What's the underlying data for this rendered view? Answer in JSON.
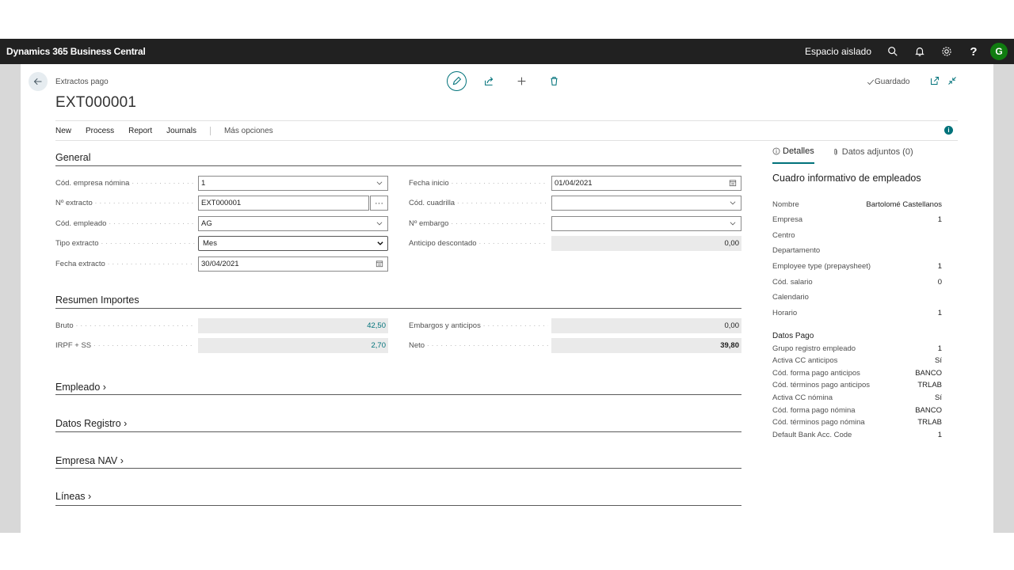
{
  "appbar": {
    "title": "Dynamics 365 Business Central",
    "sandbox": "Espacio aislado",
    "help": "?",
    "avatar": "G"
  },
  "header": {
    "caption": "Extractos pago",
    "record_no": "EXT000001",
    "saved": "Guardado"
  },
  "actions": [
    "New",
    "Process",
    "Report",
    "Journals",
    "Más opciones"
  ],
  "general": {
    "title": "General",
    "left": [
      {
        "label": "Cód. empresa nómina",
        "value": "1",
        "kind": "dropdown"
      },
      {
        "label": "Nº extracto",
        "value": "EXT000001",
        "kind": "lookup"
      },
      {
        "label": "Cód. empleado",
        "value": "AG",
        "kind": "dropdown"
      },
      {
        "label": "Tipo extracto",
        "value": "Mes",
        "kind": "select"
      },
      {
        "label": "Fecha extracto",
        "value": "30/04/2021",
        "kind": "date"
      }
    ],
    "right": [
      {
        "label": "Fecha inicio",
        "value": "01/04/2021",
        "kind": "date"
      },
      {
        "label": "Cód. cuadrilla",
        "value": "",
        "kind": "dropdown"
      },
      {
        "label": "Nº embargo",
        "value": "",
        "kind": "dropdown"
      },
      {
        "label": "Anticipo descontado",
        "value": "0,00",
        "kind": "readonly"
      }
    ]
  },
  "resumen": {
    "title": "Resumen Importes",
    "bruto_label": "Bruto",
    "bruto": "42,50",
    "irpf_label": "IRPF + SS",
    "irpf": "2,70",
    "embargos_label": "Embargos y anticipos",
    "embargos": "0,00",
    "neto_label": "Neto",
    "neto": "39,80"
  },
  "collapsed_sections": [
    "Empleado",
    "Datos Registro",
    "Empresa NAV",
    "Líneas"
  ],
  "factbox": {
    "tab_details": "Detalles",
    "tab_attachments": "Datos adjuntos (0)",
    "title": "Cuadro informativo de empleados",
    "rows": [
      {
        "label": "Nombre",
        "value": "Bartolomé Castellanos"
      },
      {
        "label": "Empresa",
        "value": "1"
      },
      {
        "label": "Centro",
        "value": ""
      },
      {
        "label": "Departamento",
        "value": ""
      },
      {
        "label": "Employee type (prepaysheet)",
        "value": "1"
      },
      {
        "label": "Cód. salario",
        "value": "0"
      },
      {
        "label": "Calendario",
        "value": ""
      },
      {
        "label": "Horario",
        "value": "1"
      }
    ],
    "pago_title": "Datos Pago",
    "pago_rows": [
      {
        "label": "Grupo registro empleado",
        "value": "1"
      },
      {
        "label": "Activa CC anticipos",
        "value": "Sí"
      },
      {
        "label": "Cód. forma pago anticipos",
        "value": "BANCO"
      },
      {
        "label": "Cód. términos pago anticipos",
        "value": "TRLAB"
      },
      {
        "label": "Activa CC nómina",
        "value": "Sí"
      },
      {
        "label": "Cód. forma pago nómina",
        "value": "BANCO"
      },
      {
        "label": "Cód. términos pago nómina",
        "value": "TRLAB"
      },
      {
        "label": "Default Bank Acc. Code",
        "value": "1"
      }
    ]
  }
}
